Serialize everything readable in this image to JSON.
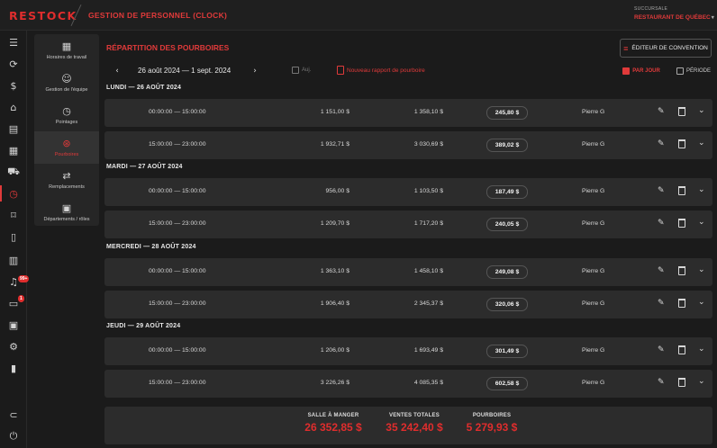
{
  "header": {
    "logo": "RESTOCK",
    "title": "GESTION DE PERSONNEL (CLOCK)",
    "branch_label": "SUCCURSALE",
    "branch_value": "RESTAURANT DE QUÉBEC"
  },
  "rail": {
    "menu_icon": "☰",
    "badge_notifications": "99+",
    "badge_messages": "1"
  },
  "submenu": [
    {
      "label": "Horaires de travail",
      "icon": "calendar-icon"
    },
    {
      "label": "Gestion de l'équipe",
      "icon": "team-icon"
    },
    {
      "label": "Pointages",
      "icon": "clock-icon"
    },
    {
      "label": "Pourboires",
      "icon": "dollar-icon"
    },
    {
      "label": "Remplacements",
      "icon": "swap-icon"
    },
    {
      "label": "Départements / rôles",
      "icon": "badge-icon"
    }
  ],
  "main": {
    "title": "RÉPARTITION DES POURBOIRES",
    "editor_button": "ÉDITEUR DE CONVENTION",
    "date_range": "26 août 2024  —  1 sept. 2024",
    "today": "Auj.",
    "new_report": "Nouveau rapport de pourboire",
    "by_day": "PAR JOUR",
    "period": "PÉRIODE"
  },
  "days": [
    {
      "title": "LUNDI  —  26 AOÛT 2024",
      "rows": [
        {
          "time": "00:00:00  —  15:00:00",
          "v1": "1 151,00 $",
          "v2": "1 358,10 $",
          "tip": "245,80 $",
          "employee": "Pierre G"
        },
        {
          "time": "15:00:00  —  23:00:00",
          "v1": "1 932,71 $",
          "v2": "3 030,69 $",
          "tip": "389,02 $",
          "employee": "Pierre G"
        }
      ]
    },
    {
      "title": "MARDI  —  27 AOÛT 2024",
      "rows": [
        {
          "time": "00:00:00  —  15:00:00",
          "v1": "956,00 $",
          "v2": "1 103,50 $",
          "tip": "187,49 $",
          "employee": "Pierre G"
        },
        {
          "time": "15:00:00  —  23:00:00",
          "v1": "1 209,70 $",
          "v2": "1 717,20 $",
          "tip": "240,05 $",
          "employee": "Pierre G"
        }
      ]
    },
    {
      "title": "MERCREDI  —  28 AOÛT 2024",
      "rows": [
        {
          "time": "00:00:00  —  15:00:00",
          "v1": "1 363,10 $",
          "v2": "1 458,10 $",
          "tip": "249,08 $",
          "employee": "Pierre G"
        },
        {
          "time": "15:00:00  —  23:00:00",
          "v1": "1 906,40 $",
          "v2": "2 345,37 $",
          "tip": "320,06 $",
          "employee": "Pierre G"
        }
      ]
    },
    {
      "title": "JEUDI  —  29 AOÛT 2024",
      "rows": [
        {
          "time": "00:00:00  —  15:00:00",
          "v1": "1 206,00 $",
          "v2": "1 693,49 $",
          "tip": "301,49 $",
          "employee": "Pierre G"
        },
        {
          "time": "15:00:00  —  23:00:00",
          "v1": "3 226,26 $",
          "v2": "4 085,35 $",
          "tip": "602,58 $",
          "employee": "Pierre G"
        }
      ]
    }
  ],
  "totals": {
    "dining_label": "SALLE À MANGER",
    "dining_value": "26 352,85 $",
    "sales_label": "VENTES TOTALES",
    "sales_value": "35 242,40 $",
    "tips_label": "POURBOIRES",
    "tips_value": "5 279,93 $"
  },
  "colors": {
    "accent": "#e02d2d",
    "background": "#1b1b1b",
    "row": "#2c2c2c"
  }
}
